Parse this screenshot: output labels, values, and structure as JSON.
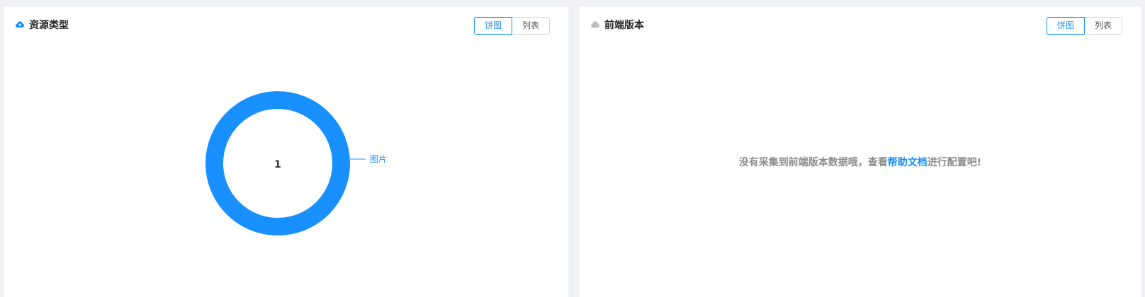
{
  "left_panel": {
    "title": "资源类型",
    "title_icon": "cloud-upload-icon",
    "toggle": {
      "pie_label": "饼图",
      "list_label": "列表",
      "active": "pie"
    }
  },
  "right_panel": {
    "title": "前端版本",
    "title_icon": "cloud-icon",
    "toggle": {
      "pie_label": "饼图",
      "list_label": "列表",
      "active": "pie"
    },
    "empty_message": {
      "before": "没有采集到前端版本数据哦，查看",
      "link": "帮助文档",
      "after": "进行配置吧!"
    }
  },
  "chart_data": {
    "type": "pie",
    "variant": "donut",
    "center_label": "1",
    "slices": [
      {
        "label": "图片",
        "value": 1
      }
    ],
    "colors": [
      "#1890ff"
    ]
  },
  "colors": {
    "accent": "#1890ff",
    "background": "#f0f2f5",
    "panel": "#ffffff"
  }
}
